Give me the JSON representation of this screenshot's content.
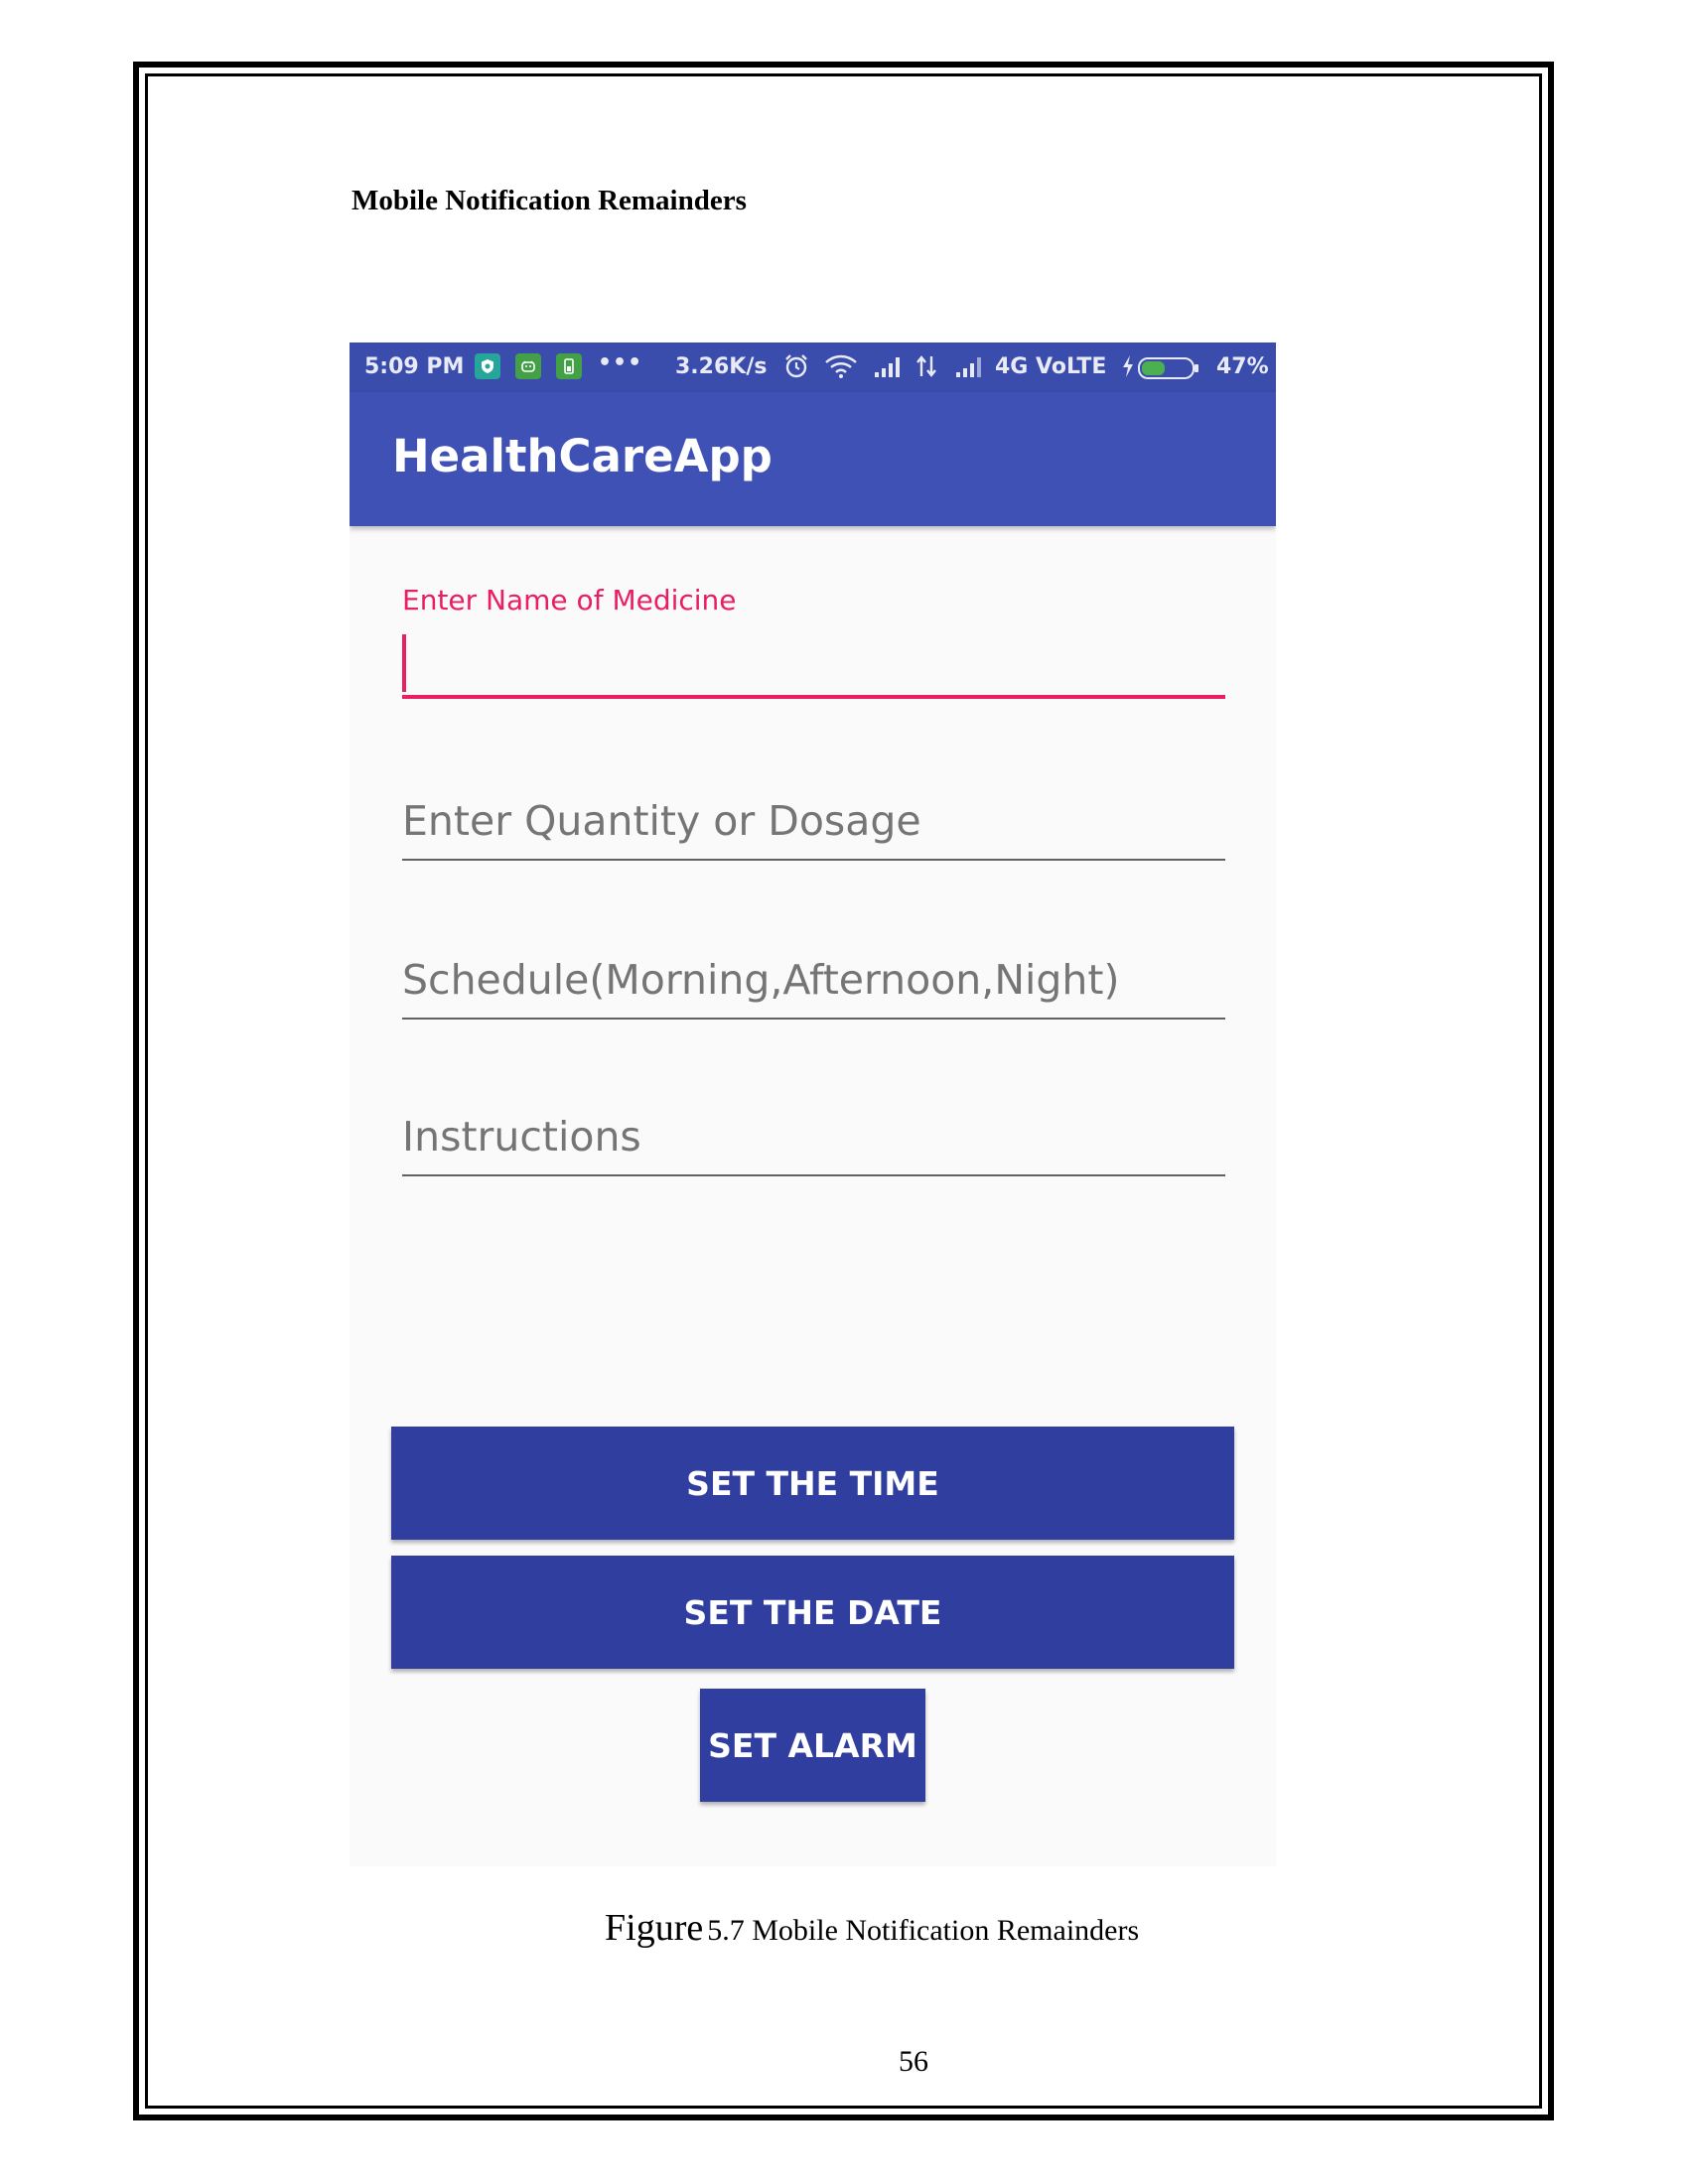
{
  "document": {
    "section_heading": "Mobile Notification Remainders",
    "caption_figure_word": "Figure",
    "caption_rest": "5.7 Mobile Notification Remainders",
    "page_number": "56"
  },
  "status_bar": {
    "time": "5:09 PM",
    "more": "•••",
    "network_speed": "3.26K/s",
    "network_label": "4G VoLTE",
    "battery_percent": "47%",
    "battery_level": 0.47,
    "icons": [
      "shield-icon",
      "android-icon",
      "battery-saver-icon",
      "alarm-icon",
      "wifi-icon",
      "signal-icon",
      "data-arrows-icon",
      "signal-icon",
      "charging-icon",
      "battery-icon"
    ]
  },
  "app_bar": {
    "title": "HealthCareApp"
  },
  "form": {
    "medicine_name": {
      "label": "Enter Name of Medicine",
      "value": ""
    },
    "quantity": {
      "placeholder": "Enter Quantity or Dosage"
    },
    "schedule": {
      "placeholder": "Schedule(Morning,Afternoon,Night)"
    },
    "instructions": {
      "placeholder": "Instructions"
    }
  },
  "buttons": {
    "set_time": "SET THE TIME",
    "set_date": "SET THE DATE",
    "set_alarm": "SET ALARM"
  },
  "colors": {
    "primary": "#3f51b5",
    "primary_dark": "#303f9f",
    "accent": "#e91e63"
  }
}
